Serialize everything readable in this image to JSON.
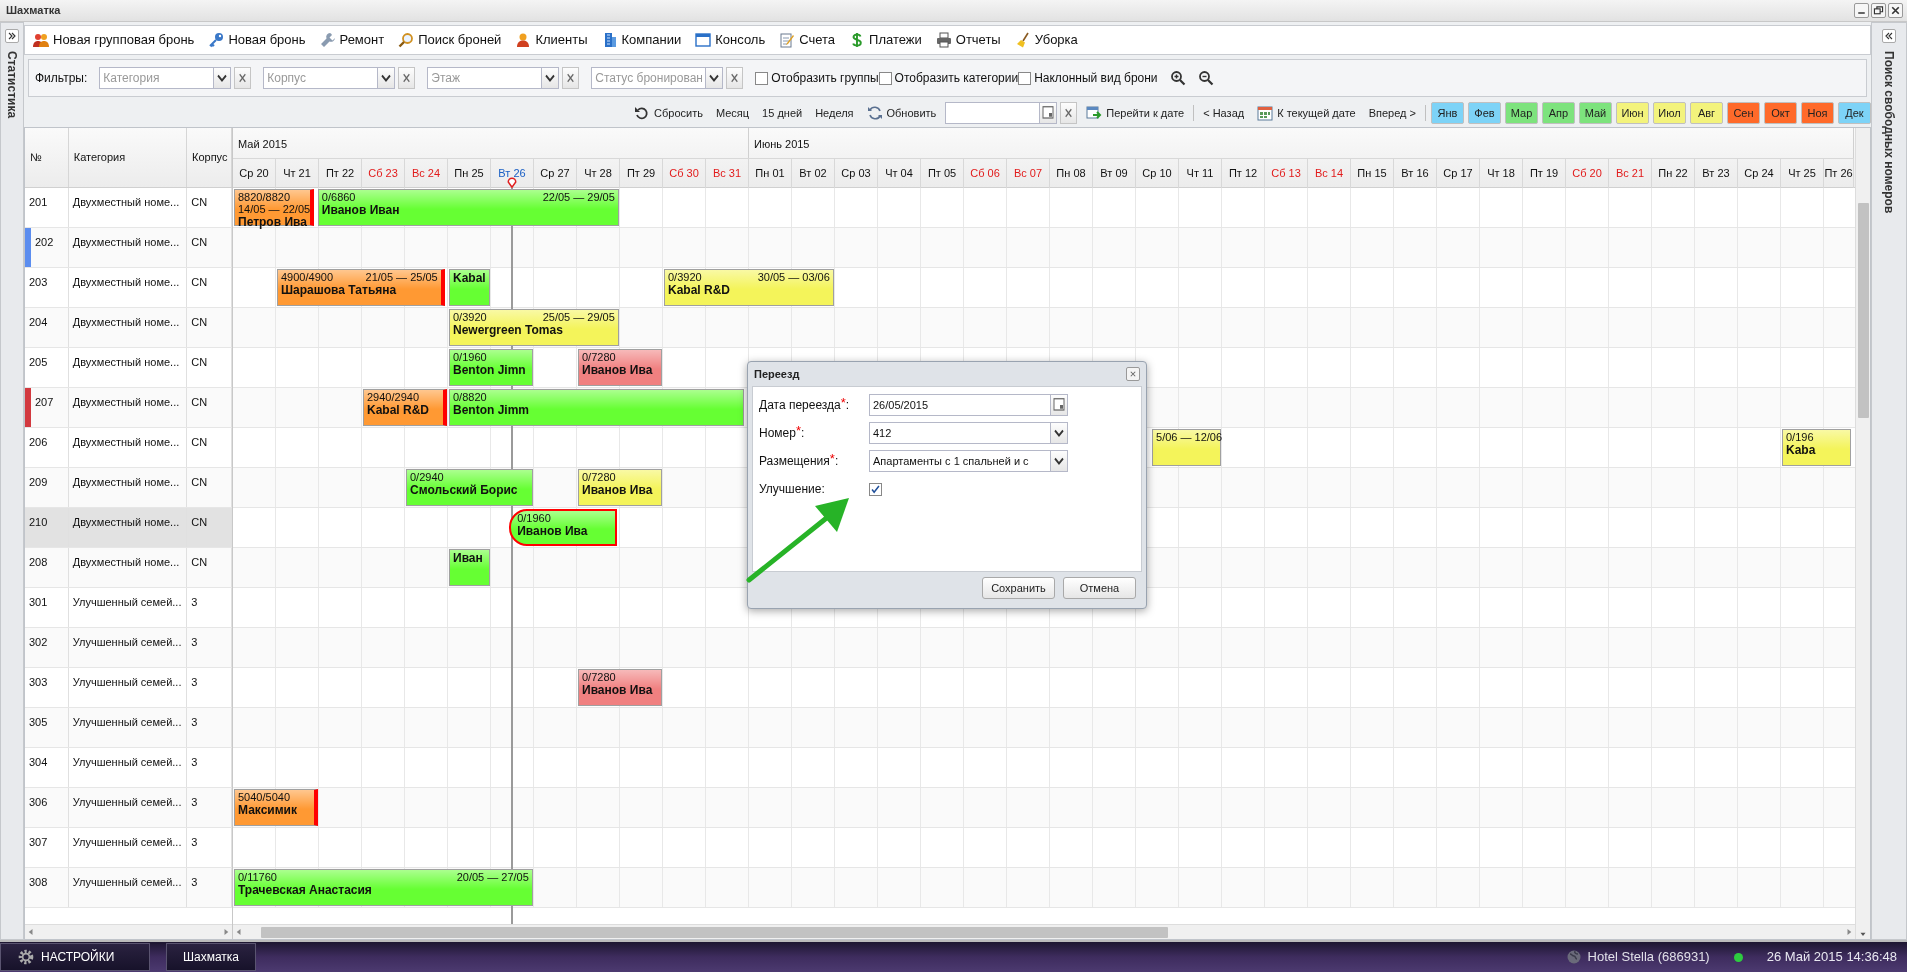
{
  "window": {
    "title": "Шахматка"
  },
  "side_panels": {
    "left": "Статистика",
    "right": "Поиск свободных номеров"
  },
  "toolbar": [
    {
      "label": "Новая групповая бронь"
    },
    {
      "label": "Новая бронь"
    },
    {
      "label": "Ремонт"
    },
    {
      "label": "Поиск броней"
    },
    {
      "label": "Клиенты"
    },
    {
      "label": "Компании"
    },
    {
      "label": "Консоль"
    },
    {
      "label": "Счета"
    },
    {
      "label": "Платежи"
    },
    {
      "label": "Отчеты"
    },
    {
      "label": "Уборка"
    }
  ],
  "filters": {
    "label": "Фильтры:",
    "combos": [
      {
        "placeholder": "Категория"
      },
      {
        "placeholder": "Корпус"
      },
      {
        "placeholder": "Этаж"
      },
      {
        "placeholder": "Статус бронирован"
      }
    ],
    "checkboxes": [
      {
        "label": "Отобразить группы",
        "checked": false
      },
      {
        "label": "Отобразить категории",
        "checked": false
      },
      {
        "label": "Наклонный вид брони",
        "checked": false
      }
    ]
  },
  "view_bar": {
    "reset": "Сбросить",
    "periods": [
      "Месяц",
      "15 дней",
      "Неделя"
    ],
    "refresh": "Обновить",
    "goto": "Перейти к дате",
    "back": "< Назад",
    "today": "К текущей дате",
    "forward": "Вперед >",
    "months": [
      {
        "label": "Янв",
        "color": "#7dd3f7"
      },
      {
        "label": "Фев",
        "color": "#7dd3f7"
      },
      {
        "label": "Мар",
        "color": "#7de37d"
      },
      {
        "label": "Апр",
        "color": "#7de37d"
      },
      {
        "label": "Май",
        "color": "#7de37d"
      },
      {
        "label": "Июн",
        "color": "#f3f37c"
      },
      {
        "label": "Июл",
        "color": "#f3f37c"
      },
      {
        "label": "Авг",
        "color": "#f3f37c"
      },
      {
        "label": "Сен",
        "color": "#ff6a2a"
      },
      {
        "label": "Окт",
        "color": "#ff6a2a"
      },
      {
        "label": "Ноя",
        "color": "#ff6a2a"
      },
      {
        "label": "Дек",
        "color": "#7dd3f7"
      }
    ]
  },
  "calendar": {
    "months": [
      {
        "label": "Май 2015",
        "days": [
          {
            "label": "Ср 20",
            "weekend": false,
            "today": false
          },
          {
            "label": "Чт 21",
            "weekend": false,
            "today": false
          },
          {
            "label": "Пт 22",
            "weekend": false,
            "today": false
          },
          {
            "label": "Сб 23",
            "weekend": true,
            "today": false
          },
          {
            "label": "Вс 24",
            "weekend": true,
            "today": false
          },
          {
            "label": "Пн 25",
            "weekend": false,
            "today": false
          },
          {
            "label": "Вт 26",
            "weekend": false,
            "today": true
          },
          {
            "label": "Ср 27",
            "weekend": false,
            "today": false
          },
          {
            "label": "Чт 28",
            "weekend": false,
            "today": false
          },
          {
            "label": "Пт 29",
            "weekend": false,
            "today": false
          },
          {
            "label": "Сб 30",
            "weekend": true,
            "today": false
          },
          {
            "label": "Вс 31",
            "weekend": true,
            "today": false
          }
        ]
      },
      {
        "label": "Июнь 2015",
        "days": [
          {
            "label": "Пн 01",
            "weekend": false,
            "today": false
          },
          {
            "label": "Вт 02",
            "weekend": false,
            "today": false
          },
          {
            "label": "Ср 03",
            "weekend": false,
            "today": false
          },
          {
            "label": "Чт 04",
            "weekend": false,
            "today": false
          },
          {
            "label": "Пт 05",
            "weekend": false,
            "today": false
          },
          {
            "label": "Сб 06",
            "weekend": true,
            "today": false
          },
          {
            "label": "Вс 07",
            "weekend": true,
            "today": false
          },
          {
            "label": "Пн 08",
            "weekend": false,
            "today": false
          },
          {
            "label": "Вт 09",
            "weekend": false,
            "today": false
          },
          {
            "label": "Ср 10",
            "weekend": false,
            "today": false
          },
          {
            "label": "Чт 11",
            "weekend": false,
            "today": false
          },
          {
            "label": "Пт 12",
            "weekend": false,
            "today": false
          },
          {
            "label": "Сб 13",
            "weekend": true,
            "today": false
          },
          {
            "label": "Вс 14",
            "weekend": true,
            "today": false
          },
          {
            "label": "Пн 15",
            "weekend": false,
            "today": false
          },
          {
            "label": "Вт 16",
            "weekend": false,
            "today": false
          },
          {
            "label": "Ср 17",
            "weekend": false,
            "today": false
          },
          {
            "label": "Чт 18",
            "weekend": false,
            "today": false
          },
          {
            "label": "Пт 19",
            "weekend": false,
            "today": false
          },
          {
            "label": "Сб 20",
            "weekend": true,
            "today": false
          },
          {
            "label": "Вс 21",
            "weekend": true,
            "today": false
          },
          {
            "label": "Пн 22",
            "weekend": false,
            "today": false
          },
          {
            "label": "Вт 23",
            "weekend": false,
            "today": false
          },
          {
            "label": "Ср 24",
            "weekend": false,
            "today": false
          },
          {
            "label": "Чт 25",
            "weekend": false,
            "today": false
          },
          {
            "label": "Пт 26",
            "weekend": false,
            "today": false
          }
        ]
      }
    ]
  },
  "grid": {
    "columns": [
      "№",
      "Категория",
      "Корпус"
    ],
    "rows": [
      {
        "number": "201",
        "category": "Двухместный номе...",
        "building": "CN",
        "selected": false,
        "bookings": [
          {
            "amount": "8820/8820",
            "dates": "14/05 — 22/05",
            "guest": "Петров Ива",
            "color": "#ff9933",
            "end_mark": true,
            "selected": false
          },
          {
            "amount": "0/6860",
            "dates": "22/05 — 29/05",
            "guest": "Иванов Иван",
            "color": "#66ff33",
            "end_mark": false,
            "selected": false
          }
        ]
      },
      {
        "number": "202",
        "category": "Двухместный номе...",
        "building": "CN",
        "selected": false,
        "color": "#5b8def"
      },
      {
        "number": "203",
        "category": "Двухместный номе...",
        "building": "CN",
        "selected": false,
        "bookings": [
          {
            "amount": "4900/4900",
            "dates": "21/05 — 25/05",
            "guest": "Шарашова Татьяна",
            "color": "#ff9933",
            "end_mark": true,
            "selected": false
          },
          {
            "guest": "Kabal",
            "color": "#66ff33",
            "end_mark": false,
            "selected": false
          },
          {
            "amount": "0/3920",
            "dates": "30/05 — 03/06",
            "guest": "Kabal R&D",
            "color": "#f4f45a",
            "end_mark": false,
            "selected": false
          }
        ]
      },
      {
        "number": "204",
        "category": "Двухместный номе...",
        "building": "CN",
        "selected": false,
        "bookings": [
          {
            "amount": "0/3920",
            "dates": "25/05 — 29/05",
            "guest": "Newergreen Tomas",
            "color": "#f4f45a",
            "end_mark": false,
            "selected": false
          }
        ]
      },
      {
        "number": "205",
        "category": "Двухместный номе...",
        "building": "CN",
        "selected": false,
        "bookings": [
          {
            "amount": "0/1960",
            "guest": "Benton Jimn",
            "color": "#66ff33",
            "end_mark": false,
            "selected": false
          },
          {
            "amount": "0/7280",
            "guest": "Иванов Ива",
            "color": "#f08080",
            "end_mark": false,
            "selected": false
          }
        ]
      },
      {
        "number": "207",
        "category": "Двухместный номе...",
        "building": "CN",
        "selected": false,
        "color": "#d2393f",
        "bookings": [
          {
            "amount": "2940/2940",
            "guest": "Kabal R&D",
            "color": "#ff9933",
            "end_mark": true,
            "selected": false
          },
          {
            "amount": "0/8820",
            "guest": "Benton Jimm",
            "color": "#66ff33",
            "end_mark": false,
            "selected": false
          }
        ]
      },
      {
        "number": "206",
        "category": "Двухместный номе...",
        "building": "CN",
        "selected": false,
        "bookings": [
          {
            "dates": "5/06 — 12/06",
            "color": "#f4f45a",
            "end_mark": false,
            "selected": false
          },
          {
            "amount": "0/196",
            "guest": "Kaba",
            "color": "#f4f45a",
            "end_mark": false,
            "selected": false
          }
        ]
      },
      {
        "number": "209",
        "category": "Двухместный номе...",
        "building": "CN",
        "selected": false,
        "bookings": [
          {
            "amount": "0/2940",
            "guest": "Смольский Борис",
            "color": "#66ff33",
            "end_mark": false,
            "selected": false
          },
          {
            "amount": "0/7280",
            "guest": "Иванов Ива",
            "color": "#f4f45a",
            "end_mark": false,
            "selected": false
          }
        ]
      },
      {
        "number": "210",
        "category": "Двухместный номе...",
        "building": "CN",
        "selected": true,
        "bookings": [
          {
            "amount": "0/1960",
            "guest": "Иванов Ива",
            "color": "#66ff33",
            "end_mark": false,
            "selected": true
          }
        ]
      },
      {
        "number": "208",
        "category": "Двухместный номе...",
        "building": "CN",
        "selected": false,
        "bookings": [
          {
            "guest": "Иван",
            "color": "#66ff33",
            "end_mark": false,
            "selected": false
          }
        ]
      },
      {
        "number": "301",
        "category": "Улучшенный семей...",
        "building": "3",
        "selected": false
      },
      {
        "number": "302",
        "category": "Улучшенный семей...",
        "building": "3",
        "selected": false
      },
      {
        "number": "303",
        "category": "Улучшенный семей...",
        "building": "3",
        "selected": false,
        "bookings": [
          {
            "amount": "0/7280",
            "guest": "Иванов Ива",
            "color": "#f08080",
            "end_mark": false,
            "selected": false
          }
        ]
      },
      {
        "number": "305",
        "category": "Улучшенный семей...",
        "building": "3",
        "selected": false
      },
      {
        "number": "304",
        "category": "Улучшенный семей...",
        "building": "3",
        "selected": false
      },
      {
        "number": "306",
        "category": "Улучшенный семей...",
        "building": "3",
        "selected": false,
        "bookings": [
          {
            "amount": "5040/5040",
            "guest": "Максимик",
            "color": "#ff9933",
            "end_mark": true,
            "selected": false
          }
        ]
      },
      {
        "number": "307",
        "category": "Улучшенный семей...",
        "building": "3",
        "selected": false
      },
      {
        "number": "308",
        "category": "Улучшенный семей...",
        "building": "3",
        "selected": false,
        "bookings": [
          {
            "amount": "0/11760",
            "dates": "20/05 — 27/05",
            "guest": "Трачевская Анастасия",
            "color": "#66ff33",
            "end_mark": false,
            "selected": false
          }
        ]
      }
    ]
  },
  "dialog": {
    "title": "Переезд",
    "fields": [
      {
        "kind": "date",
        "label": "Дата переезда$^{*}$:",
        "value": "26/05/2015"
      },
      {
        "kind": "combo",
        "label": "Номер$^{*}$:",
        "value": "412"
      },
      {
        "kind": "combo",
        "label": "Размещения$^{*}$:",
        "value": "Апартаменты с 1 спальней и с"
      },
      {
        "kind": "checkbox",
        "label": "Улучшение:",
        "checked": true
      }
    ],
    "buttons": [
      "Сохранить",
      "Отмена"
    ]
  },
  "taskbar": {
    "start": "НАСТРОЙКИ",
    "window": "Шахматка",
    "hotel": "Hotel Stella (686931)",
    "online": true,
    "clock": "26 Май 2015 14:36:48"
  }
}
